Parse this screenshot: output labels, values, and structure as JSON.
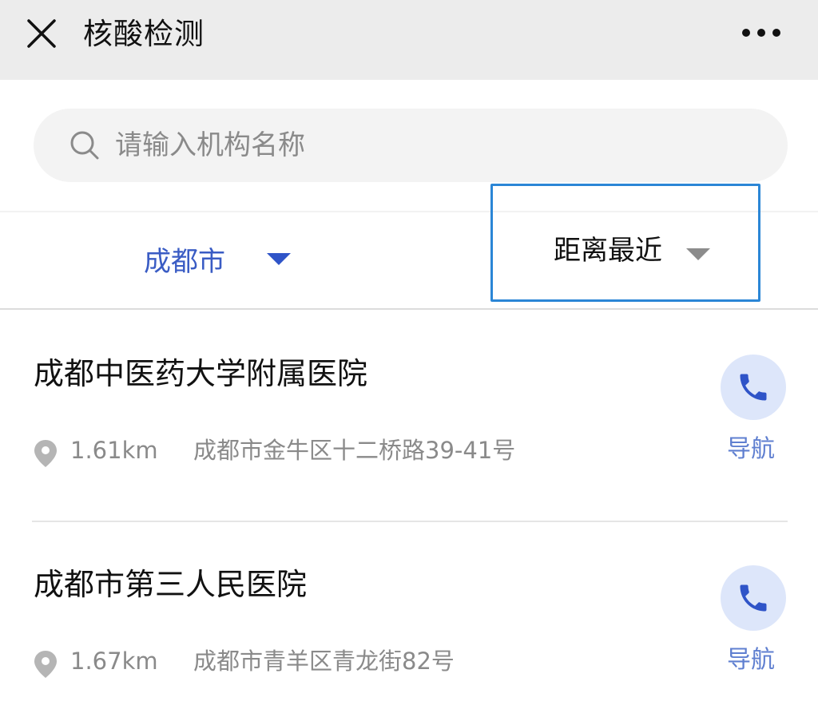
{
  "header": {
    "title": "核酸检测",
    "close_icon": "close-icon",
    "more_icon": "more-icon"
  },
  "search": {
    "placeholder": "请输入机构名称",
    "value": "",
    "icon": "search-icon"
  },
  "filters": {
    "city": {
      "label": "成都市",
      "arrow_color": "#2f54c8"
    },
    "sort": {
      "label": "距离最近",
      "highlight_color": "#2b86d6"
    }
  },
  "hospitals": [
    {
      "name": "成都中医药大学附属医院",
      "distance": "1.61km",
      "address": "成都市金牛区十二桥路39-41号",
      "phone_icon": "phone-icon",
      "nav_label": "导航"
    },
    {
      "name": "成都市第三人民医院",
      "distance": "1.67km",
      "address": "成都市青羊区青龙街82号",
      "phone_icon": "phone-icon",
      "nav_label": "导航"
    }
  ],
  "colors": {
    "accent_blue": "#3a5cc4",
    "link_blue": "#5f7fd0",
    "phone_bg": "#dde6fa",
    "header_bg": "#ececec"
  }
}
